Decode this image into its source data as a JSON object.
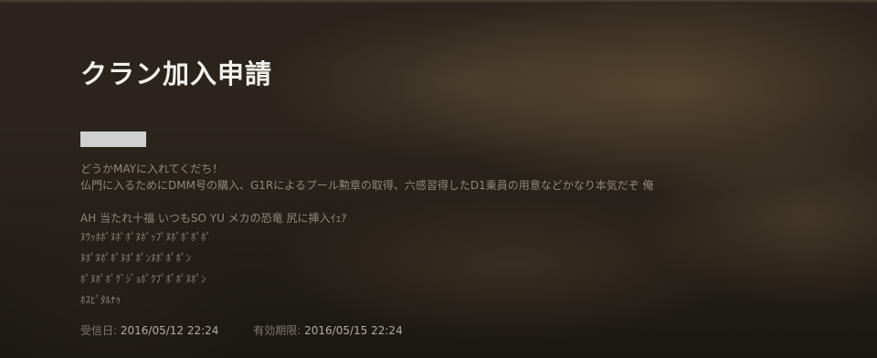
{
  "page": {
    "title": "クラン加入申請"
  },
  "message": {
    "lines": [
      "どうかMAYに入れてくだち！",
      "仏門に入るためにDMM号の購入、G1Rによるプール勲章の取得、六感習得したD1乗員の用意などかなり本気だぞ 俺",
      "AH 当たれ十福 いつもSO YU メカの恐竜 尻に挿入ｲｪｱ",
      "ﾇｳｯﾎﾎﾟﾇﾎﾟﾎﾟﾇﾎﾟｯﾌﾟﾇﾎﾟﾎﾟﾎﾟﾎﾟ",
      "ﾇﾎﾟﾇﾎﾟﾎﾟﾇﾎﾟﾎﾟﾝﾇﾎﾟﾎﾟﾎﾟﾝ",
      "ﾎﾟﾇﾎﾟﾎﾟｸﾞｼﾞｮﾎﾟｸﾌﾟﾎﾟﾎﾟﾇﾎﾟﾝ",
      "ﾎｽﾋﾟﾀﾙﾅｩ"
    ]
  },
  "footer": {
    "received_label": "受信日:",
    "received_value": "2016/05/12 22:24",
    "expires_label": "有効期限:",
    "expires_value": "2016/05/15 22:24"
  }
}
